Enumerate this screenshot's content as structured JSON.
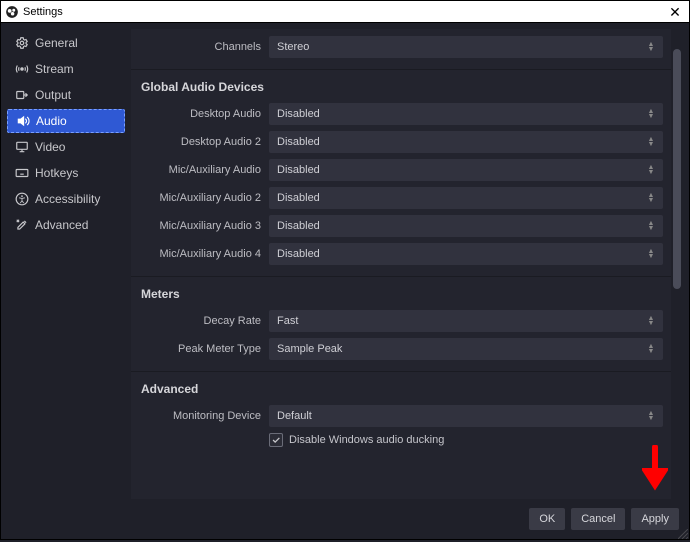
{
  "window": {
    "title": "Settings"
  },
  "sidebar": {
    "items": [
      {
        "label": "General",
        "icon": "gear-icon"
      },
      {
        "label": "Stream",
        "icon": "antenna-icon"
      },
      {
        "label": "Output",
        "icon": "output-icon"
      },
      {
        "label": "Audio",
        "icon": "speaker-icon"
      },
      {
        "label": "Video",
        "icon": "monitor-icon"
      },
      {
        "label": "Hotkeys",
        "icon": "keyboard-icon"
      },
      {
        "label": "Accessibility",
        "icon": "accessibility-icon"
      },
      {
        "label": "Advanced",
        "icon": "tools-icon"
      }
    ],
    "active_index": 3
  },
  "content": {
    "top_row": {
      "label": "Channels",
      "value": "Stereo"
    },
    "sections": [
      {
        "heading": "Global Audio Devices",
        "rows": [
          {
            "label": "Desktop Audio",
            "value": "Disabled"
          },
          {
            "label": "Desktop Audio 2",
            "value": "Disabled"
          },
          {
            "label": "Mic/Auxiliary Audio",
            "value": "Disabled"
          },
          {
            "label": "Mic/Auxiliary Audio 2",
            "value": "Disabled"
          },
          {
            "label": "Mic/Auxiliary Audio 3",
            "value": "Disabled"
          },
          {
            "label": "Mic/Auxiliary Audio 4",
            "value": "Disabled"
          }
        ]
      },
      {
        "heading": "Meters",
        "rows": [
          {
            "label": "Decay Rate",
            "value": "Fast"
          },
          {
            "label": "Peak Meter Type",
            "value": "Sample Peak"
          }
        ]
      },
      {
        "heading": "Advanced",
        "rows": [
          {
            "label": "Monitoring Device",
            "value": "Default"
          }
        ],
        "checkbox": {
          "checked": true,
          "label": "Disable Windows audio ducking"
        }
      }
    ]
  },
  "footer": {
    "buttons": {
      "ok": "OK",
      "cancel": "Cancel",
      "apply": "Apply"
    }
  }
}
